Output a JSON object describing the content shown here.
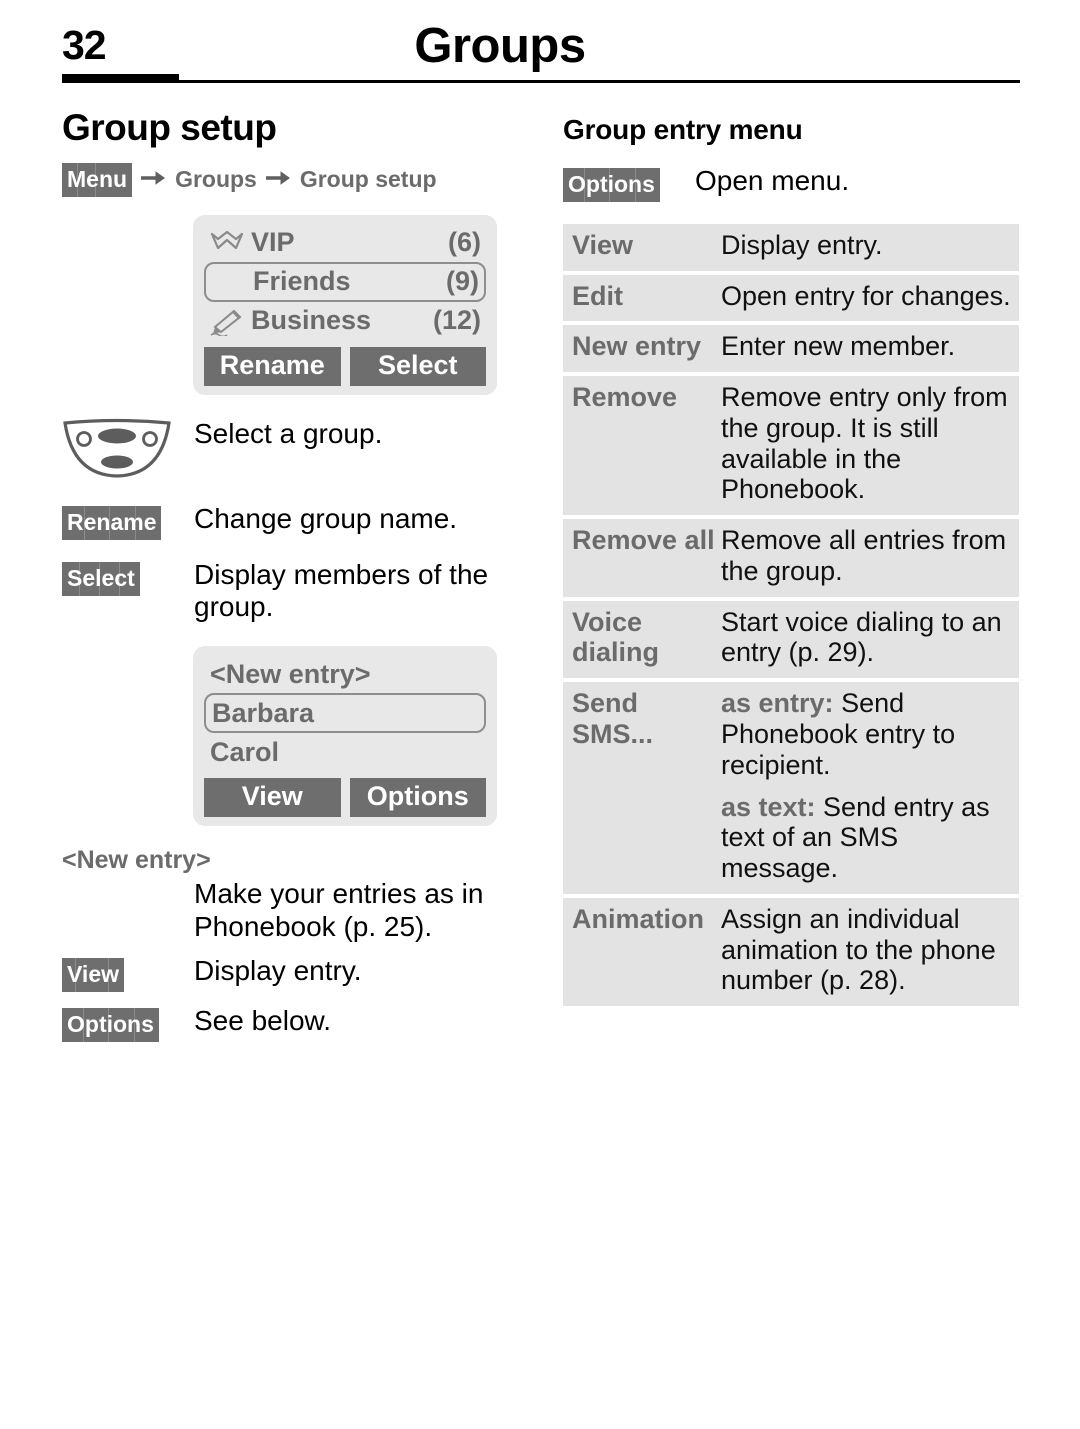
{
  "header": {
    "page_number": "32",
    "chapter_title": "Groups"
  },
  "left": {
    "section_title": "Group setup",
    "breadcrumb": {
      "softkey": "Menu",
      "arrow": "right-arrow-icon",
      "step1": "Groups",
      "step2": "Group setup"
    },
    "group_screen": {
      "rows": [
        {
          "icon": "crown-icon",
          "label": "VIP",
          "count": "(6)",
          "selected": false
        },
        {
          "icon": "",
          "label": "Friends",
          "count": "(9)",
          "selected": true
        },
        {
          "icon": "pen-icon",
          "label": "Business",
          "count": "(12)",
          "selected": false
        }
      ],
      "softkeys": [
        "Rename",
        "Select"
      ]
    },
    "actions": [
      {
        "key_type": "navkey",
        "key": "navigation-key-icon",
        "desc": "Select a group."
      },
      {
        "key_type": "softkey",
        "key": "Rename",
        "desc": "Change group name."
      },
      {
        "key_type": "softkey",
        "key": "Select",
        "desc": "Display members of the\ngroup."
      }
    ],
    "members_screen": {
      "rows": [
        {
          "label": "<New entry>",
          "selected": false
        },
        {
          "label": "Barbara",
          "selected": true
        },
        {
          "label": "Carol",
          "selected": false
        }
      ],
      "softkeys": [
        "View",
        "Options"
      ]
    },
    "new_entry_block": {
      "heading": "<New entry>",
      "desc": "Make your entries as in Phonebook (p. 25)."
    },
    "actions2": [
      {
        "key_type": "softkey",
        "key": "View",
        "desc": "Display entry."
      },
      {
        "key_type": "softkey",
        "key": "Options",
        "desc": "See below."
      }
    ]
  },
  "right": {
    "section_title": "Group entry menu",
    "intro": {
      "softkey": "Options",
      "desc": "Open menu."
    },
    "options": [
      {
        "term": "View",
        "lines": [
          {
            "lead": "",
            "text": "Display entry."
          }
        ]
      },
      {
        "term": "Edit",
        "lines": [
          {
            "lead": "",
            "text": "Open entry for changes."
          }
        ]
      },
      {
        "term": "New entry",
        "lines": [
          {
            "lead": "",
            "text": "Enter new member."
          }
        ]
      },
      {
        "term": "Remove",
        "lines": [
          {
            "lead": "",
            "text": "Remove entry only from the group. It is still available in the Phonebook."
          }
        ]
      },
      {
        "term": "Remove all",
        "lines": [
          {
            "lead": "",
            "text": "Remove all entries from the group."
          }
        ]
      },
      {
        "term": "Voice dialing",
        "lines": [
          {
            "lead": "",
            "text": "Start voice dialing to an entry (p. 29)."
          }
        ]
      },
      {
        "term": "Send SMS...",
        "lines": [
          {
            "lead": "as entry:",
            "text": " Send Phonebook entry to recipient."
          },
          {
            "lead": "as text:",
            "text": " Send entry as text of an SMS message."
          }
        ]
      },
      {
        "term": "Animation",
        "lines": [
          {
            "lead": "",
            "text": "Assign an individual animation to the phone number (p. 28)."
          }
        ]
      }
    ]
  },
  "colors": {
    "softkey_bg": "#6e6e6e",
    "screen_bg": "#e8e8e8",
    "table_row_bg": "#e3e3e3",
    "muted_text": "#6b6b6b"
  }
}
